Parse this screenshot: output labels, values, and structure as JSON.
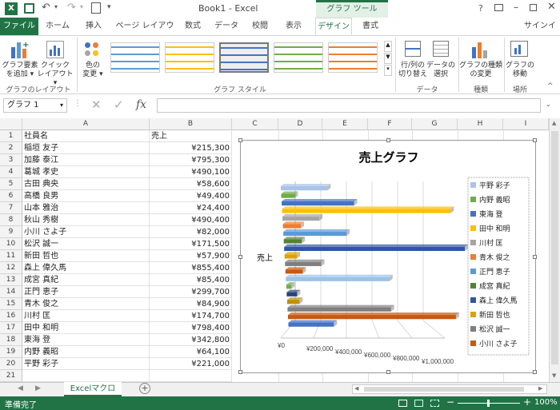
{
  "window": {
    "title": "Book1 - Excel",
    "chart_tools": "グラフ ツール",
    "signin": "サインイ"
  },
  "tabs": [
    "ファイル",
    "ホーム",
    "挿入",
    "ページ レイアウト",
    "数式",
    "データ",
    "校閲",
    "表示",
    "デザイン",
    "書式"
  ],
  "ribbon": {
    "add_element": "グラフ要素\nを追加",
    "quick_layout": "クイック\nレイアウト",
    "change_color": "色の\n変更",
    "switch_rowcol": "行/列の\n切り替え",
    "select_data": "データの\n選択",
    "change_type": "グラフの種類\nの変更",
    "move_chart": "グラフの\n移動",
    "groups": {
      "layout": "グラフのレイアウト",
      "style": "グラフ スタイル",
      "data": "データ",
      "type": "種類",
      "location": "場所"
    }
  },
  "formula_bar": {
    "name_box": "グラフ 1",
    "fx": "fx",
    "value": ""
  },
  "columns": [
    "A",
    "B",
    "C",
    "D",
    "E",
    "F",
    "G",
    "H",
    "I"
  ],
  "rows": [
    {
      "n": "1",
      "a": "社員名",
      "b": "売上"
    },
    {
      "n": "2",
      "a": "稲垣 友子",
      "b": "¥215,300"
    },
    {
      "n": "3",
      "a": "加藤 泰江",
      "b": "¥795,300"
    },
    {
      "n": "4",
      "a": "葛城 孝史",
      "b": "¥490,100"
    },
    {
      "n": "5",
      "a": "古田 典央",
      "b": "¥58,600"
    },
    {
      "n": "6",
      "a": "高橋 良男",
      "b": "¥49,400"
    },
    {
      "n": "7",
      "a": "山本 雅治",
      "b": "¥24,400"
    },
    {
      "n": "8",
      "a": "秋山 秀樹",
      "b": "¥490,400"
    },
    {
      "n": "9",
      "a": "小川 さよ子",
      "b": "¥82,000"
    },
    {
      "n": "10",
      "a": "松沢 誠一",
      "b": "¥171,500"
    },
    {
      "n": "11",
      "a": "新田 哲也",
      "b": "¥57,900"
    },
    {
      "n": "12",
      "a": "森上 偉久馬",
      "b": "¥855,400"
    },
    {
      "n": "13",
      "a": "成宮 真紀",
      "b": "¥85,400"
    },
    {
      "n": "14",
      "a": "正門 恵子",
      "b": "¥299,700"
    },
    {
      "n": "15",
      "a": "青木 俊之",
      "b": "¥84,900"
    },
    {
      "n": "16",
      "a": "川村 匡",
      "b": "¥174,700"
    },
    {
      "n": "17",
      "a": "田中 和明",
      "b": "¥798,400"
    },
    {
      "n": "18",
      "a": "東海 登",
      "b": "¥342,800"
    },
    {
      "n": "19",
      "a": "内野 義昭",
      "b": "¥64,100"
    },
    {
      "n": "20",
      "a": "平野 彩子",
      "b": "¥221,000"
    },
    {
      "n": "21",
      "a": "",
      "b": ""
    },
    {
      "n": "22",
      "a": "",
      "b": ""
    }
  ],
  "chart_data": {
    "type": "bar",
    "title": "売上グラフ",
    "ylabel": "売上",
    "xlim": [
      0,
      1000000
    ],
    "xticks": [
      "¥0",
      "¥200,000",
      "¥400,000",
      "¥600,000",
      "¥800,000",
      "¥1,000,000"
    ],
    "series": [
      {
        "name": "平野 彩子",
        "value": 221000,
        "color": "#a9c4e8"
      },
      {
        "name": "内野 義昭",
        "value": 64100,
        "color": "#70ad47"
      },
      {
        "name": "東海 登",
        "value": 342800,
        "color": "#4472c4"
      },
      {
        "name": "田中 和明",
        "value": 798400,
        "color": "#ffc000"
      },
      {
        "name": "川村 匡",
        "value": 174700,
        "color": "#a5a5a5"
      },
      {
        "name": "青木 俊之",
        "value": 84900,
        "color": "#ed7d31"
      },
      {
        "name": "正門 恵子",
        "value": 299700,
        "color": "#5b9bd5"
      },
      {
        "name": "成宮 真紀",
        "value": 85400,
        "color": "#548235"
      },
      {
        "name": "森上 偉久馬",
        "value": 855400,
        "color": "#2f55a4"
      },
      {
        "name": "新田 哲也",
        "value": 57900,
        "color": "#d9a300"
      },
      {
        "name": "松沢 誠一",
        "value": 171500,
        "color": "#7f7f7f"
      },
      {
        "name": "小川 さよ子",
        "value": 82000,
        "color": "#c55a11"
      },
      {
        "name": "秋山 秀樹",
        "value": 490400,
        "color": "#9dc3e6"
      },
      {
        "name": "山本 雅治",
        "value": 24400,
        "color": "#70ad47"
      },
      {
        "name": "高橋 良男",
        "value": 49400,
        "color": "#264478"
      },
      {
        "name": "古田 典央",
        "value": 58600,
        "color": "#bf9000"
      },
      {
        "name": "葛城 孝史",
        "value": 490100,
        "color": "#7f7f7f"
      },
      {
        "name": "加藤 泰江",
        "value": 795300,
        "color": "#c55a11"
      },
      {
        "name": "稲垣 友子",
        "value": 215300,
        "color": "#4472c4"
      }
    ],
    "legend": [
      "平野 彩子",
      "内野 義昭",
      "東海 登",
      "田中 和明",
      "川村 匡",
      "青木 俊之",
      "正門 恵子",
      "成宮 真紀",
      "森上 偉久馬",
      "新田 哲也",
      "松沢 誠一",
      "小川 さよ子"
    ],
    "legend_position": "right"
  },
  "sheet": {
    "tab": "Excelマクロ"
  },
  "status": {
    "ready": "準備完了",
    "zoom": "100%"
  }
}
